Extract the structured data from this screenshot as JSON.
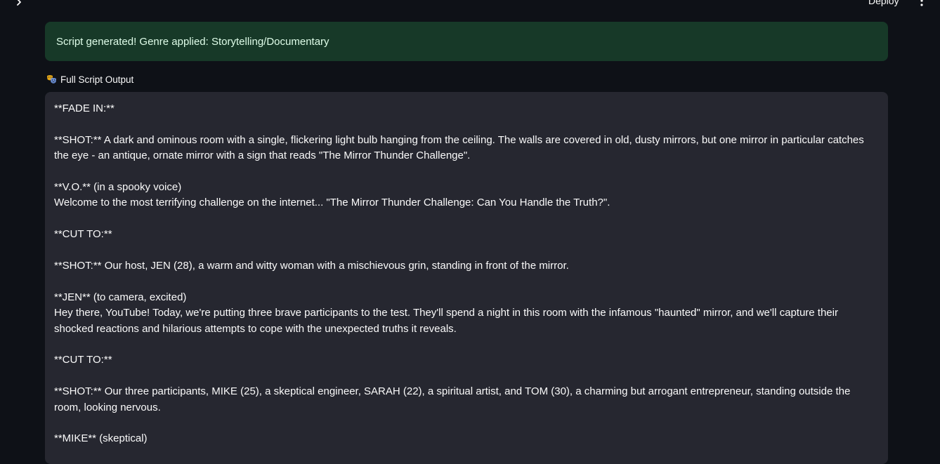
{
  "header": {
    "deploy_label": "Deploy",
    "sidebar_toggle_icon": "chevron-right-icon",
    "menu_icon": "vertical-dots-icon"
  },
  "alert": {
    "message": "Script generated! Genre applied: Storytelling/Documentary",
    "bg_color": "#173928"
  },
  "output": {
    "label": "Full Script Output",
    "label_icon": "performing-arts-masks-icon",
    "blocks": [
      [
        "**FADE IN:**"
      ],
      [
        "**SHOT:** A dark and ominous room with a single, flickering light bulb hanging from the ceiling. The walls are covered in old, dusty mirrors, but one mirror in particular catches the eye - an antique, ornate mirror with a sign that reads \"The Mirror Thunder Challenge\"."
      ],
      [
        "**V.O.** (in a spooky voice)",
        "Welcome to the most terrifying challenge on the internet... \"The Mirror Thunder Challenge: Can You Handle the Truth?\"."
      ],
      [
        "**CUT TO:**"
      ],
      [
        "**SHOT:** Our host, JEN (28), a warm and witty woman with a mischievous grin, standing in front of the mirror."
      ],
      [
        "**JEN** (to camera, excited)",
        "Hey there, YouTube! Today, we're putting three brave participants to the test. They'll spend a night in this room with the infamous \"haunted\" mirror, and we'll capture their shocked reactions and hilarious attempts to cope with the unexpected truths it reveals."
      ],
      [
        "**CUT TO:**"
      ],
      [
        "**SHOT:** Our three participants, MIKE (25), a skeptical engineer, SARAH (22), a spiritual artist, and TOM (30), a charming but arrogant entrepreneur, standing outside the room, looking nervous."
      ],
      [
        "**MIKE** (skeptical)"
      ]
    ]
  }
}
